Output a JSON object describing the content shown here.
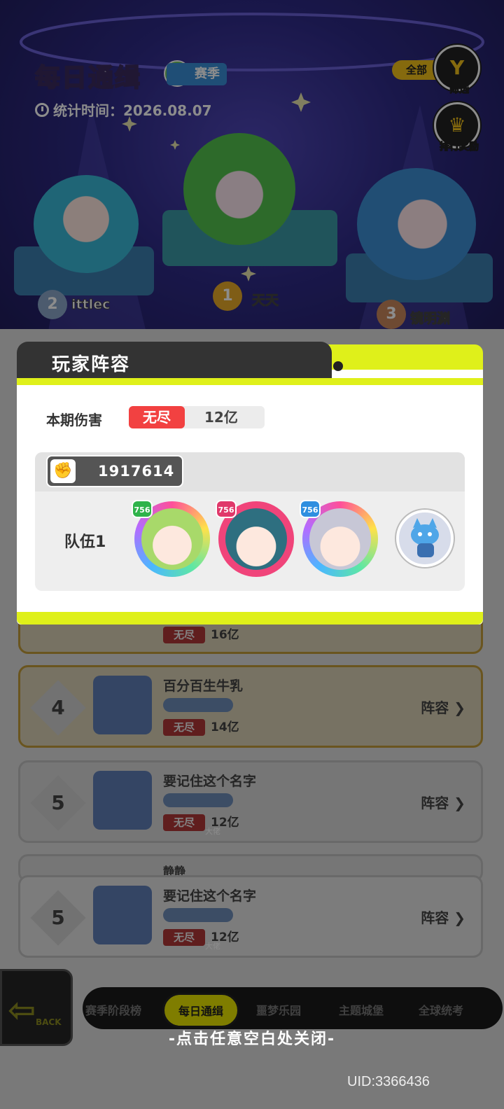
{
  "header": {
    "title": "每日通缉",
    "season_tag": "赛季",
    "stat_time": "统计时间：2026.08.07",
    "filter_label": "全部",
    "filter_button": "筛选",
    "reward_button": "排行奖励"
  },
  "podium": [
    {
      "rank": "2",
      "name": "ittlec"
    },
    {
      "rank": "1",
      "name": "天天"
    },
    {
      "rank": "3",
      "name": "镜明渊"
    }
  ],
  "modal": {
    "title": "玩家阵容",
    "damage_label": "本期伤害",
    "damage_tag": "无尽",
    "damage_value": "12亿",
    "power_value": "1917614",
    "team_label": "队伍1",
    "members": [
      {
        "level": "756",
        "name": "green-hair-character"
      },
      {
        "level": "756",
        "name": "teal-hair-character"
      },
      {
        "level": "756",
        "name": "silver-hair-character"
      }
    ]
  },
  "list": [
    {
      "rank": "",
      "name": "",
      "tag": "无尽",
      "damage": "16亿",
      "lineup": ""
    },
    {
      "rank": "4",
      "name": "百分百生牛乳",
      "badge": "",
      "tag": "无尽",
      "damage": "14亿",
      "lineup": "阵容"
    },
    {
      "rank": "5",
      "name": "要记住这个名字",
      "badge": "大佬",
      "tag": "无尽",
      "damage": "12亿",
      "lineup": "阵容"
    },
    {
      "rank": "5",
      "name": "要记住这个名字",
      "badge": "大佬",
      "tag": "无尽",
      "damage": "12亿",
      "lineup": "阵容"
    }
  ],
  "partial_row_name": "静静",
  "nav": {
    "back": "BACK",
    "items": [
      "赛季阶段榜",
      "每日通缉",
      "噩梦乐园",
      "主题城堡",
      "全球统考"
    ]
  },
  "close_hint": "-点击任意空白处关闭-",
  "uid": "UID:3366436",
  "colors": {
    "accent_yellow": "#dff01a",
    "endless_red": "#f24141",
    "power_grey": "#555555"
  }
}
